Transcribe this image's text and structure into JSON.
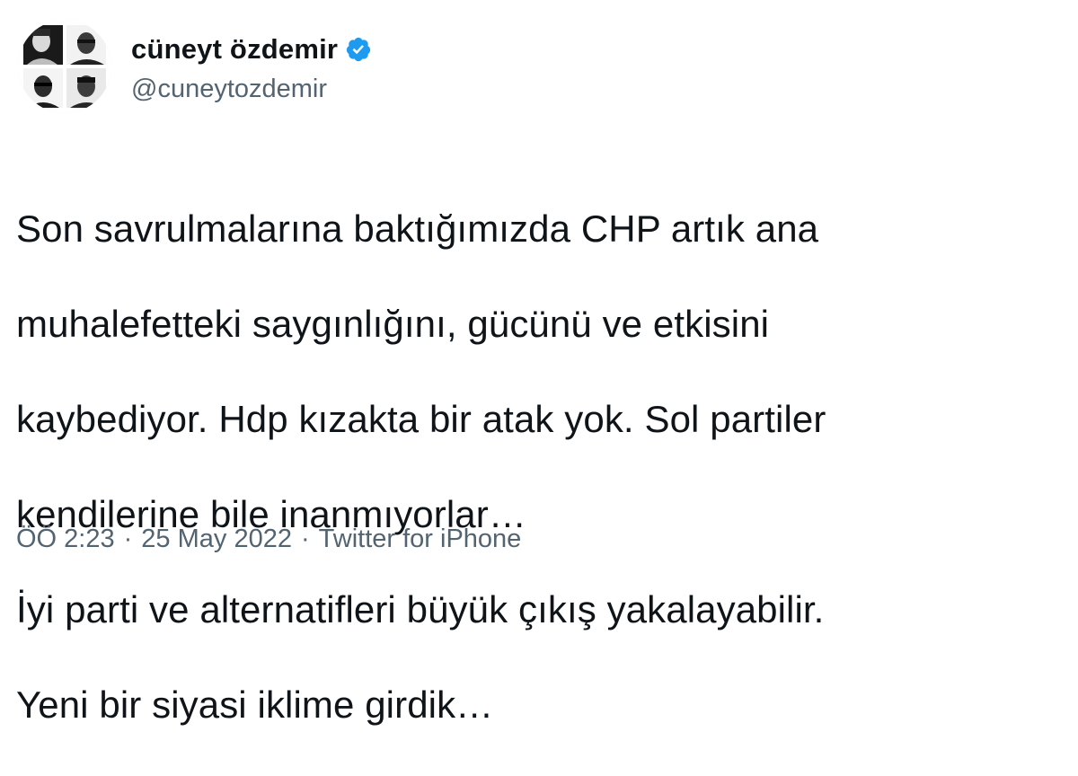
{
  "author": {
    "display_name": "cüneyt özdemir",
    "handle": "@cuneytozdemir",
    "verified_icon": "verified-badge-icon",
    "verified_color": "#1d9bf0",
    "avatar_icon": "avatar-photo-grid"
  },
  "tweet": {
    "lines": [
      "Son savrulmalarına baktığımızda CHP artık ana",
      "muhalefetteki saygınlığını, gücünü ve etkisini",
      "kaybediyor. Hdp kızakta bir atak yok. Sol partiler",
      "kendilerine bile inanmıyorlar…",
      "İyi parti ve alternatifleri büyük çıkış yakalayabilir.",
      "Yeni bir siyasi iklime girdik…"
    ]
  },
  "meta": {
    "time": "ÖÖ 2:23",
    "separator": "·",
    "date": "25 May 2022",
    "source": "Twitter for iPhone"
  },
  "colors": {
    "text": "#0f1419",
    "secondary": "#536471",
    "background": "#ffffff"
  }
}
